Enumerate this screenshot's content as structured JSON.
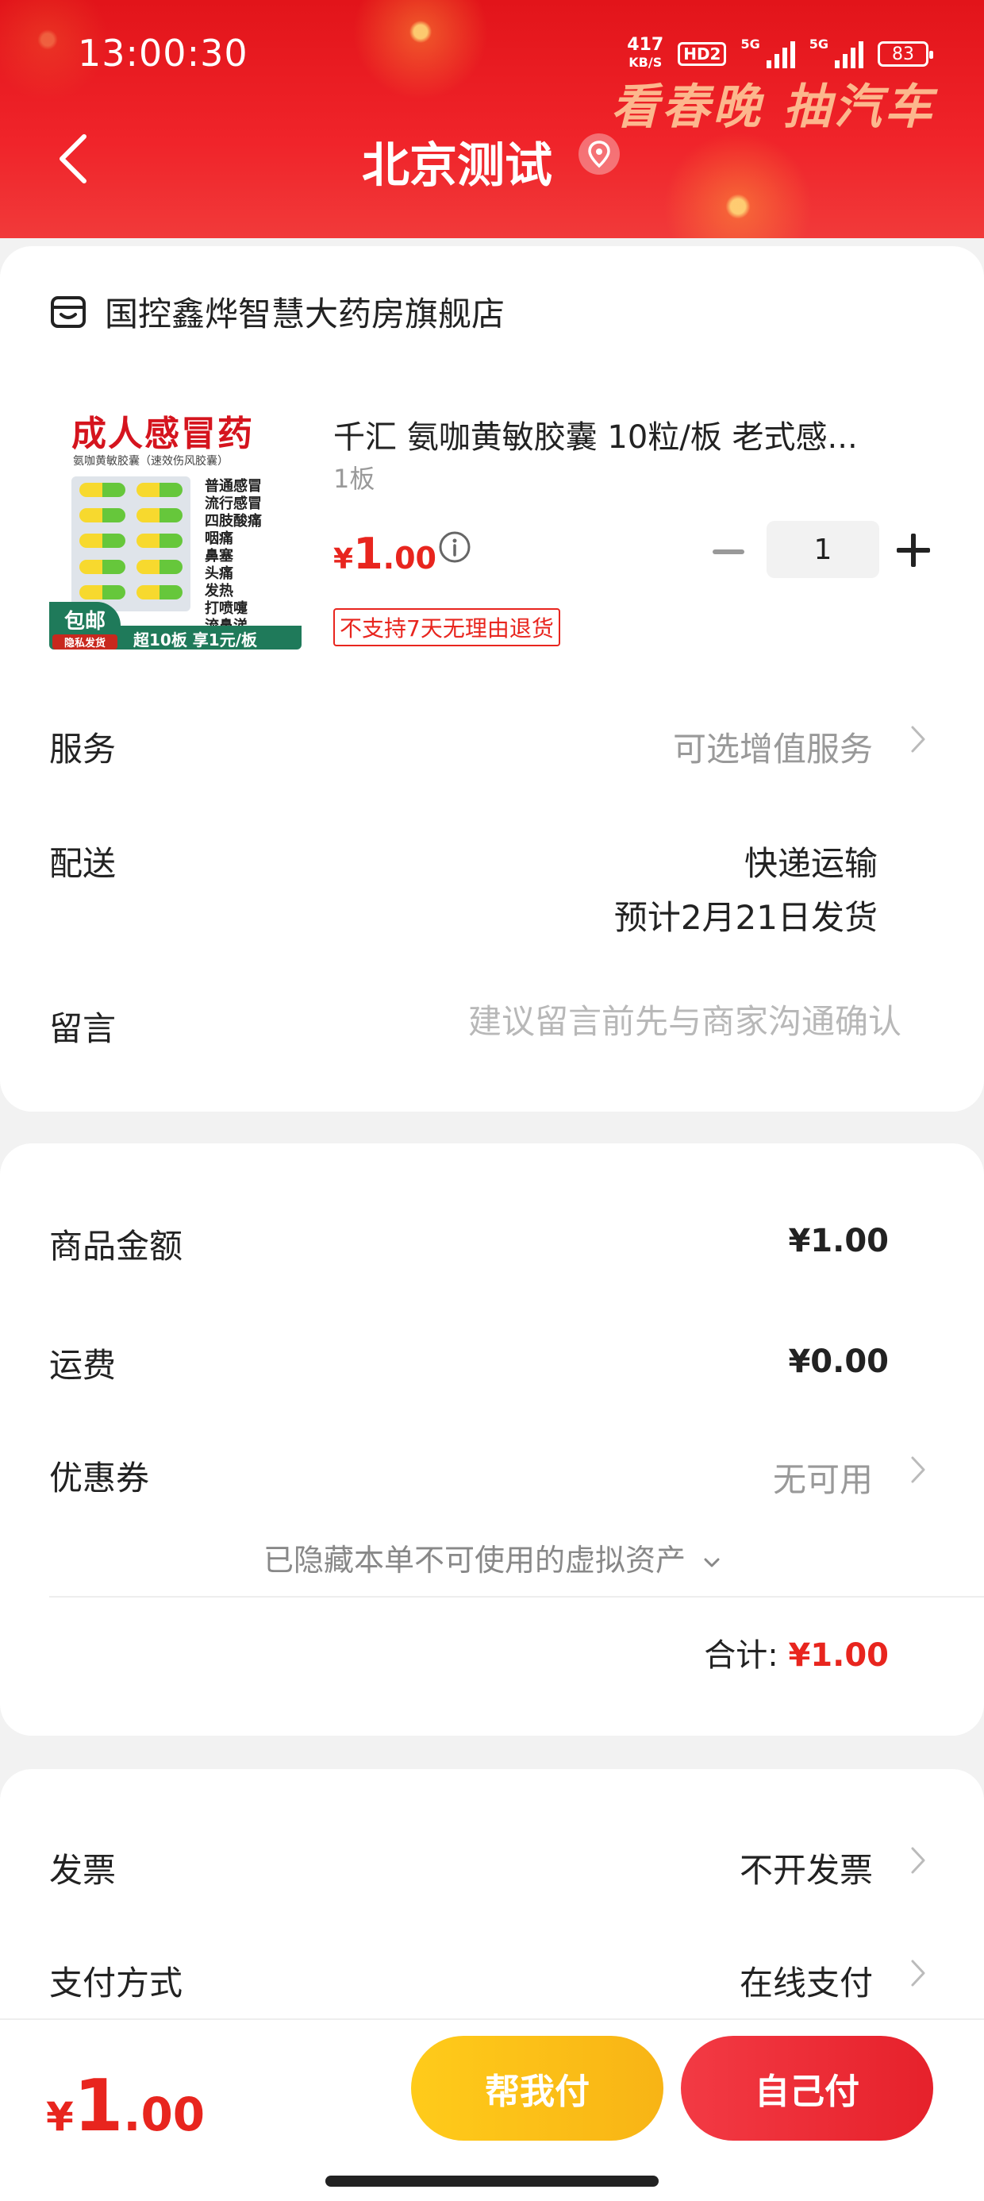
{
  "status_bar": {
    "time": "13:00:30",
    "net_speed_value": "417",
    "net_speed_unit": "KB/S",
    "hd_badge": "HD2",
    "signal1_label": "5G",
    "signal2_label": "5G",
    "battery": "83"
  },
  "header": {
    "title": "北京测试",
    "promo_text": "看春晚 抽汽车",
    "background_color": "#e2141a"
  },
  "store": {
    "name": "国控鑫烨智慧大药房旗舰店",
    "icon": "store-icon"
  },
  "product": {
    "title": "千汇 氨咖黄敏胶囊 10粒/板 老式感...",
    "spec": "1板",
    "price_symbol": "¥",
    "price_int": "1",
    "price_dec": ".00",
    "quantity": "1",
    "return_tag": "不支持7天无理由退货",
    "image": {
      "title": "成人感冒药",
      "subtitle": "氨咖黄敏胶囊（速效伤风胶囊）",
      "symptoms": [
        "普通感冒",
        "流行感冒",
        "四肢酸痛",
        "咽痛",
        "鼻塞",
        "头痛",
        "发热",
        "打喷嚏",
        "流鼻涕"
      ],
      "badge": "包邮",
      "badge_sub": "隐私发货",
      "bottom_text": "超10板 享1元/板"
    }
  },
  "order_rows": {
    "service_label": "服务",
    "service_value": "可选增值服务",
    "delivery_label": "配送",
    "delivery_method": "快递运输",
    "delivery_eta": "预计2月21日发货",
    "message_label": "留言",
    "message_placeholder": "建议留言前先与商家沟通确认"
  },
  "summary": {
    "amount_label": "商品金额",
    "amount_value": "¥1.00",
    "shipping_label": "运费",
    "shipping_value": "¥0.00",
    "coupon_label": "优惠券",
    "coupon_value": "无可用",
    "hidden_note": "已隐藏本单不可使用的虚拟资产",
    "total_label": "合计:",
    "total_value": "¥1.00"
  },
  "payment": {
    "invoice_label": "发票",
    "invoice_value": "不开发票",
    "method_label": "支付方式",
    "method_value": "在线支付"
  },
  "bottom_bar": {
    "price_symbol": "¥",
    "price_int": "1",
    "price_dec": ".00",
    "help_pay_label": "帮我付",
    "self_pay_label": "自己付"
  },
  "colors": {
    "accent_red": "#e8251e",
    "help_pay_yellow": "#ffcb1a",
    "self_pay_red": "#e6212b"
  }
}
